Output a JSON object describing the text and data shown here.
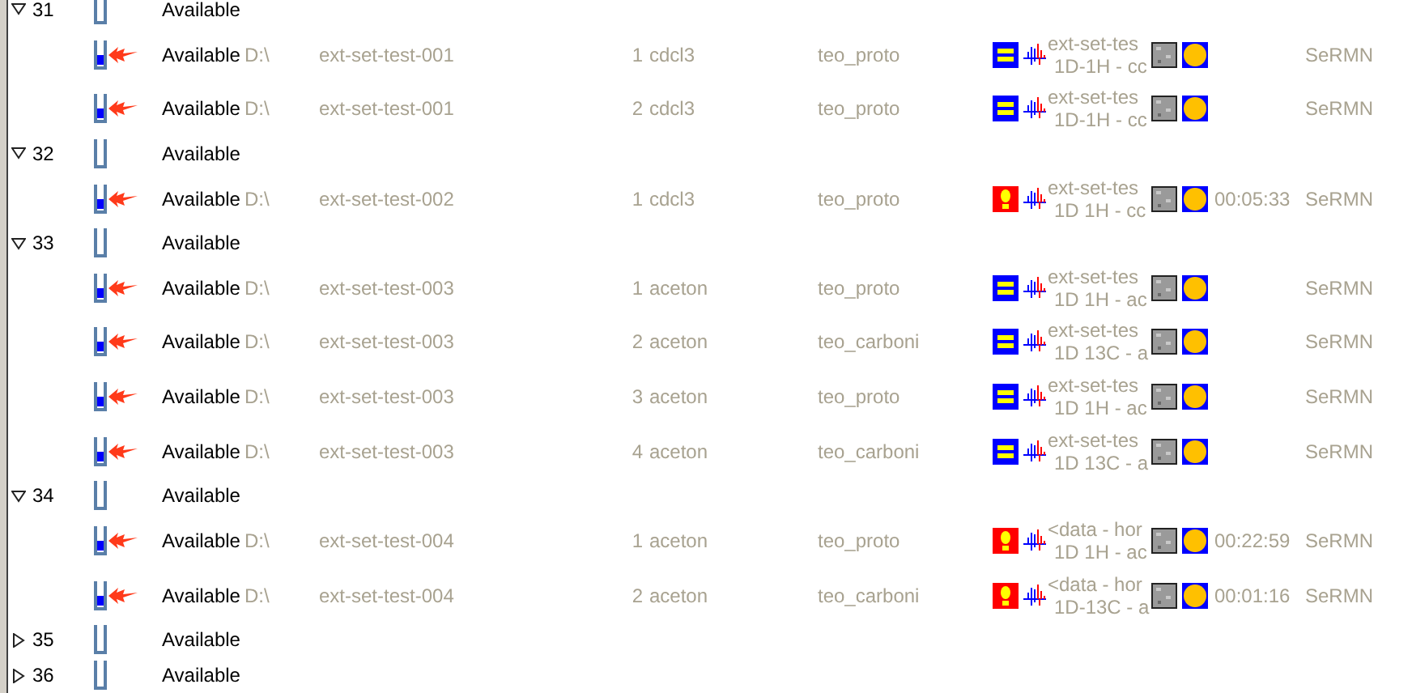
{
  "groups": [
    {
      "number": "31",
      "expanded": true,
      "status": "Available",
      "samples": [
        {
          "status": "Available",
          "drive": "D:\\",
          "name": "ext-set-test-001",
          "index": "1",
          "solvent": "cdcl3",
          "experiment": "teo_proto",
          "kind": "ok",
          "title": [
            "ext-set-tes",
            "1D-1H - cc"
          ],
          "owner": "SeRMN"
        },
        {
          "status": "Available",
          "drive": "D:\\",
          "name": "ext-set-test-001",
          "index": "2",
          "solvent": "cdcl3",
          "experiment": "teo_proto",
          "kind": "ok",
          "title": [
            "ext-set-tes",
            "1D-1H - cc"
          ],
          "owner": "SeRMN"
        }
      ]
    },
    {
      "number": "32",
      "expanded": true,
      "status": "Available",
      "samples": [
        {
          "status": "Available",
          "drive": "D:\\",
          "name": "ext-set-test-002",
          "index": "1",
          "solvent": "cdcl3",
          "experiment": "teo_proto",
          "kind": "alert",
          "title": [
            "ext-set-tes",
            "1D 1H - cc"
          ],
          "time": "00:05:33",
          "owner": "SeRMN"
        }
      ]
    },
    {
      "number": "33",
      "expanded": true,
      "status": "Available",
      "samples": [
        {
          "status": "Available",
          "drive": "D:\\",
          "name": "ext-set-test-003",
          "index": "1",
          "solvent": "aceton",
          "experiment": "teo_proto",
          "kind": "ok",
          "title": [
            "ext-set-tes",
            "1D 1H - ac"
          ],
          "owner": "SeRMN"
        },
        {
          "status": "Available",
          "drive": "D:\\",
          "name": "ext-set-test-003",
          "index": "2",
          "solvent": "aceton",
          "experiment": "teo_carboni",
          "kind": "ok",
          "title": [
            "ext-set-tes",
            "1D 13C - a"
          ],
          "owner": "SeRMN"
        },
        {
          "status": "Available",
          "drive": "D:\\",
          "name": "ext-set-test-003",
          "index": "3",
          "solvent": "aceton",
          "experiment": "teo_proto",
          "kind": "ok",
          "title": [
            "ext-set-tes",
            "1D 1H - ac"
          ],
          "owner": "SeRMN"
        },
        {
          "status": "Available",
          "drive": "D:\\",
          "name": "ext-set-test-003",
          "index": "4",
          "solvent": "aceton",
          "experiment": "teo_carboni",
          "kind": "ok",
          "title": [
            "ext-set-tes",
            "1D 13C - a"
          ],
          "owner": "SeRMN"
        }
      ]
    },
    {
      "number": "34",
      "expanded": true,
      "status": "Available",
      "samples": [
        {
          "status": "Available",
          "drive": "D:\\",
          "name": "ext-set-test-004",
          "index": "1",
          "solvent": "aceton",
          "experiment": "teo_proto",
          "kind": "alert",
          "title": [
            "<data - hor",
            "1D 1H - ac"
          ],
          "time": "00:22:59",
          "owner": "SeRMN"
        },
        {
          "status": "Available",
          "drive": "D:\\",
          "name": "ext-set-test-004",
          "index": "2",
          "solvent": "aceton",
          "experiment": "teo_carboni",
          "kind": "alert",
          "title": [
            "<data - hor",
            "1D-13C - a"
          ],
          "time": "00:01:16",
          "owner": "SeRMN"
        }
      ]
    },
    {
      "number": "35",
      "expanded": false,
      "status": "Available"
    },
    {
      "number": "36",
      "expanded": false,
      "status": "Available"
    }
  ]
}
